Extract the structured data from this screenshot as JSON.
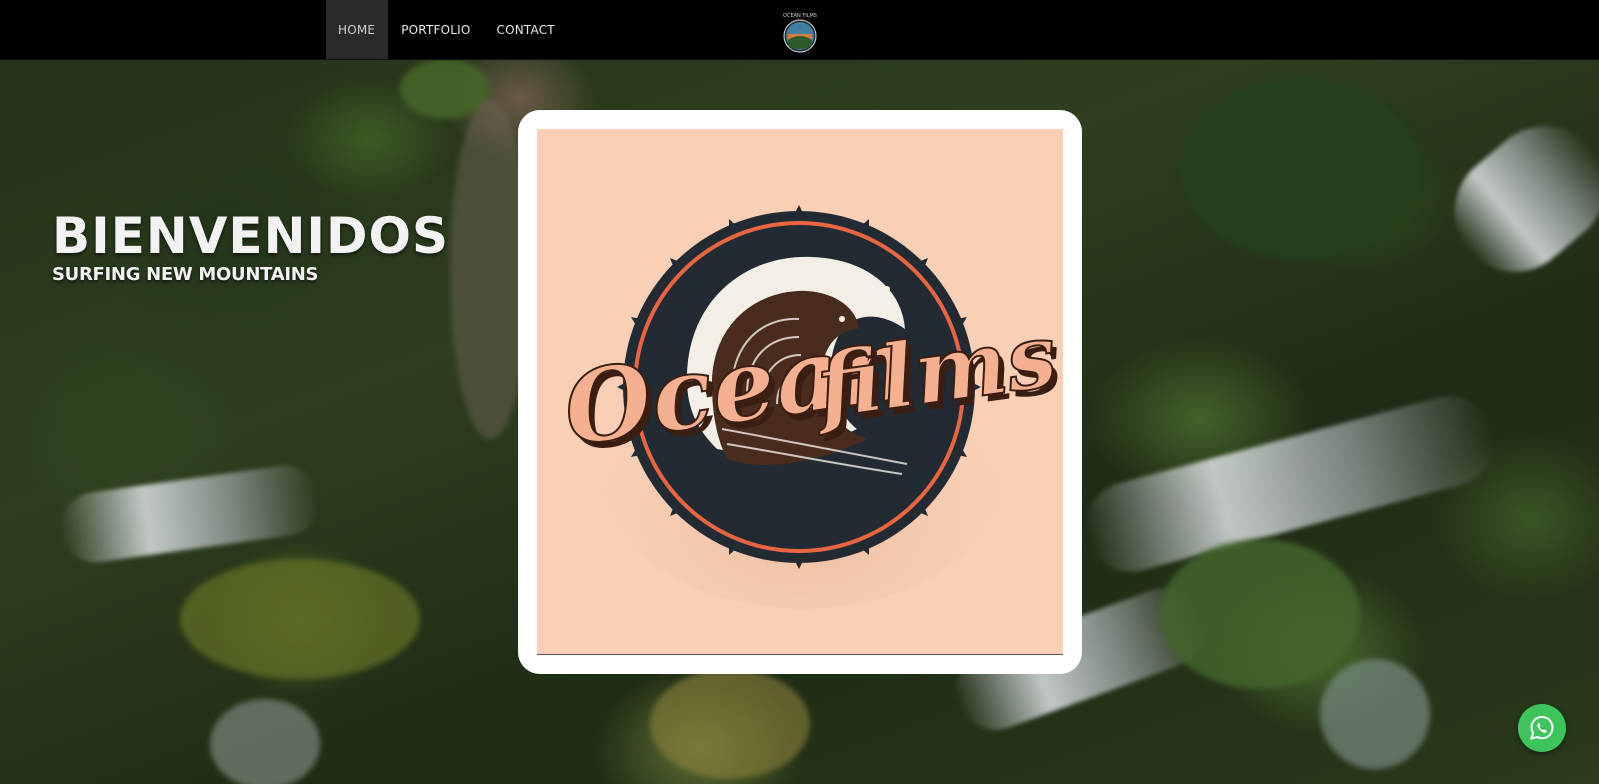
{
  "nav": {
    "items": [
      {
        "label": "HOME",
        "active": true
      },
      {
        "label": "PORTFOLIO",
        "active": false
      },
      {
        "label": "CONTACT",
        "active": false
      }
    ],
    "logo_icon": "ocean-films-logo"
  },
  "hero": {
    "title": "BIENVENIDOS",
    "subtitle": "SURFING NEW MOUNTAINS"
  },
  "card": {
    "logo_text_1": "Ocean",
    "logo_text_2": "films"
  },
  "floating": {
    "icon": "whatsapp-icon"
  },
  "colors": {
    "nav_bg": "#000000",
    "card_bg": "#f9d0b6",
    "logo_dark": "#222a33",
    "logo_accent": "#e8653f",
    "whatsapp": "#3dc45b"
  }
}
